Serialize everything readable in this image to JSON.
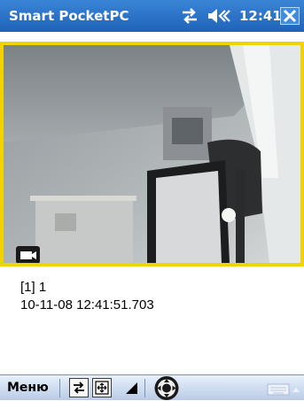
{
  "titlebar": {
    "app_title": "Smart PocketPC",
    "time": "12:41",
    "icons": [
      "connectivity-icon",
      "volume-icon",
      "close-icon"
    ]
  },
  "video": {
    "overlay_icon": "camera-icon"
  },
  "info": {
    "line1": "[1] 1",
    "line2": "10-11-08 12:41:51.703"
  },
  "menubar": {
    "menu_label": "Меню",
    "icons": [
      "swap-icon",
      "fit-screen-icon",
      "signal-icon",
      "ptz-control-icon",
      "keyboard-icon"
    ]
  },
  "colors": {
    "titlebar": "#1f63b9",
    "video_border": "#f2d300",
    "menubar": "#c9d8ed"
  }
}
